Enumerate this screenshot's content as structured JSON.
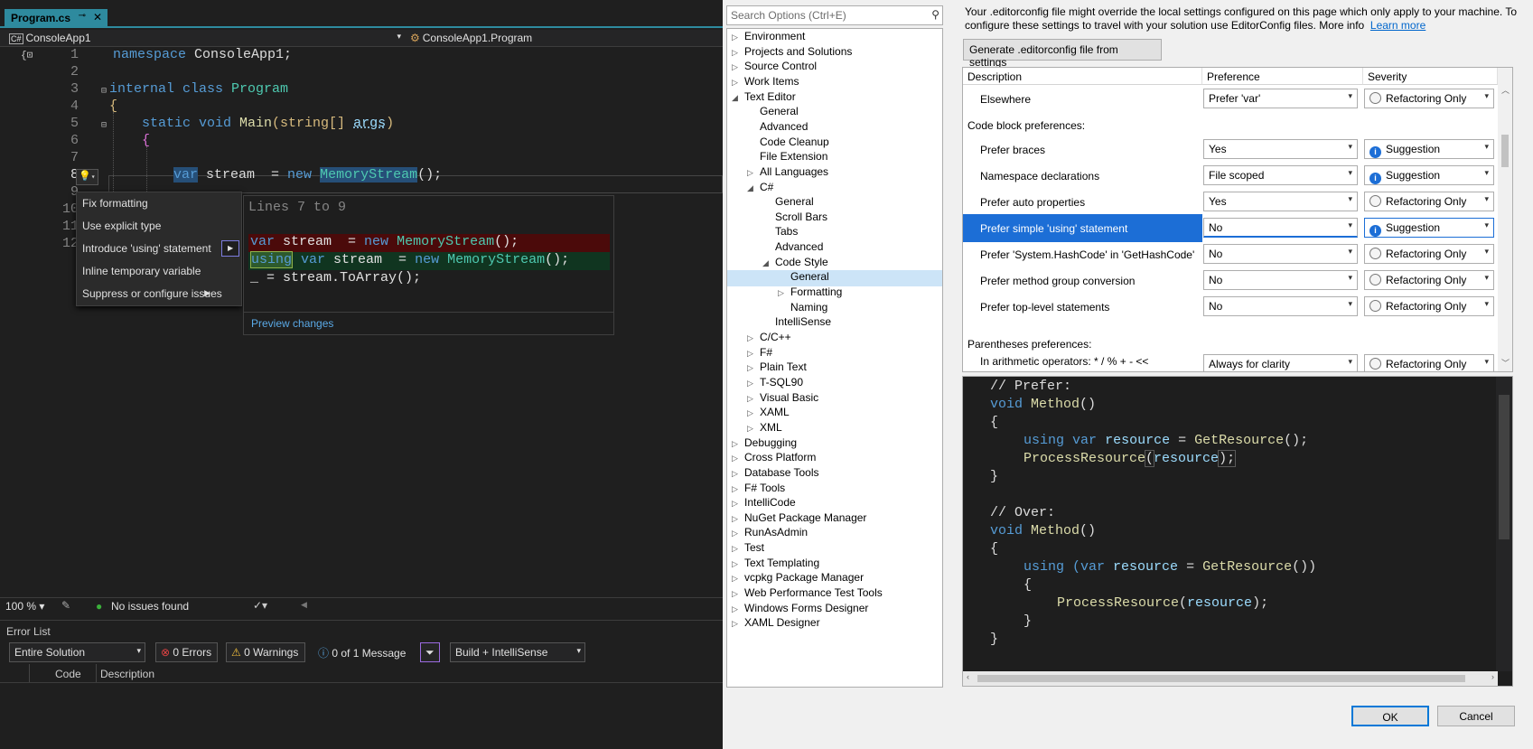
{
  "ide": {
    "tab_title": "Program.cs",
    "tab_pin": "⊸",
    "tab_close": "✕",
    "nav_project": "ConsoleApp1",
    "nav_type": "ConsoleApp1.Program",
    "line_numbers": [
      "1",
      "2",
      "3",
      "4",
      "5",
      "6",
      "7",
      "8",
      "9",
      "10",
      "11",
      "12"
    ],
    "code": {
      "l1_kw": "namespace",
      "l1_rest": " ConsoleApp1;",
      "l3_kw": "internal",
      "l3_kw2": " class ",
      "l3_ty": "Program",
      "l4": "{",
      "l5_kw": "static",
      "l5_kw2": " void ",
      "l5_mt": "Main",
      "l5_rest": "(string[] ",
      "l5_pm": "args",
      "l5_end": ")",
      "l6": "{",
      "l8_kw": "var",
      "l8_rest": " stream  = ",
      "l8_new": "new",
      "l8_ty": "MemoryStream",
      "l8_end": "();"
    },
    "quick_actions": {
      "items": [
        {
          "label": "Fix formatting"
        },
        {
          "label": "Use explicit type"
        },
        {
          "label": "Introduce 'using' statement"
        },
        {
          "label": "Inline temporary variable"
        },
        {
          "label": "Suppress or configure issues"
        }
      ]
    },
    "preview": {
      "header": "Lines 7 to 9",
      "removed_kw": "var",
      "removed_rest": " stream  = ",
      "removed_new": "new",
      "removed_ty": "MemoryStream",
      "removed_end": "();",
      "added_using": "using",
      "added_kw": "var",
      "added_rest": " stream  = ",
      "added_new": "new",
      "added_ty": "MemoryStream",
      "added_end": "();",
      "line3": "_ = stream.ToArray();",
      "preview_link": "Preview changes"
    },
    "status": {
      "zoom": "100 %",
      "issues": "No issues found"
    },
    "error_list": {
      "title": "Error List",
      "scope": "Entire Solution",
      "errors": "0 Errors",
      "warnings": "0 Warnings",
      "messages": "0 of 1 Message",
      "build_filter": "Build + IntelliSense",
      "col_code": "Code",
      "col_desc": "Description"
    }
  },
  "options": {
    "search_placeholder": "Search Options (Ctrl+E)",
    "tree": [
      {
        "label": "Environment",
        "level": 0,
        "arrow": "▷"
      },
      {
        "label": "Projects and Solutions",
        "level": 0,
        "arrow": "▷"
      },
      {
        "label": "Source Control",
        "level": 0,
        "arrow": "▷"
      },
      {
        "label": "Work Items",
        "level": 0,
        "arrow": "▷"
      },
      {
        "label": "Text Editor",
        "level": 0,
        "arrow": "◢"
      },
      {
        "label": "General",
        "level": 1,
        "arrow": ""
      },
      {
        "label": "Advanced",
        "level": 1,
        "arrow": ""
      },
      {
        "label": "Code Cleanup",
        "level": 1,
        "arrow": ""
      },
      {
        "label": "File Extension",
        "level": 1,
        "arrow": ""
      },
      {
        "label": "All Languages",
        "level": 1,
        "arrow": "▷"
      },
      {
        "label": "C#",
        "level": 1,
        "arrow": "◢"
      },
      {
        "label": "General",
        "level": 2,
        "arrow": ""
      },
      {
        "label": "Scroll Bars",
        "level": 2,
        "arrow": ""
      },
      {
        "label": "Tabs",
        "level": 2,
        "arrow": ""
      },
      {
        "label": "Advanced",
        "level": 2,
        "arrow": ""
      },
      {
        "label": "Code Style",
        "level": 2,
        "arrow": "◢"
      },
      {
        "label": "General",
        "level": 3,
        "arrow": ""
      },
      {
        "label": "Formatting",
        "level": 3,
        "arrow": "▷"
      },
      {
        "label": "Naming",
        "level": 3,
        "arrow": ""
      },
      {
        "label": "IntelliSense",
        "level": 2,
        "arrow": ""
      },
      {
        "label": "C/C++",
        "level": 1,
        "arrow": "▷"
      },
      {
        "label": "F#",
        "level": 1,
        "arrow": "▷"
      },
      {
        "label": "Plain Text",
        "level": 1,
        "arrow": "▷"
      },
      {
        "label": "T-SQL90",
        "level": 1,
        "arrow": "▷"
      },
      {
        "label": "Visual Basic",
        "level": 1,
        "arrow": "▷"
      },
      {
        "label": "XAML",
        "level": 1,
        "arrow": "▷"
      },
      {
        "label": "XML",
        "level": 1,
        "arrow": "▷"
      },
      {
        "label": "Debugging",
        "level": 0,
        "arrow": "▷"
      },
      {
        "label": "Cross Platform",
        "level": 0,
        "arrow": "▷"
      },
      {
        "label": "Database Tools",
        "level": 0,
        "arrow": "▷"
      },
      {
        "label": "F# Tools",
        "level": 0,
        "arrow": "▷"
      },
      {
        "label": "IntelliCode",
        "level": 0,
        "arrow": "▷"
      },
      {
        "label": "NuGet Package Manager",
        "level": 0,
        "arrow": "▷"
      },
      {
        "label": "RunAsAdmin",
        "level": 0,
        "arrow": "▷"
      },
      {
        "label": "Test",
        "level": 0,
        "arrow": "▷"
      },
      {
        "label": "Text Templating",
        "level": 0,
        "arrow": "▷"
      },
      {
        "label": "vcpkg Package Manager",
        "level": 0,
        "arrow": "▷"
      },
      {
        "label": "Web Performance Test Tools",
        "level": 0,
        "arrow": "▷"
      },
      {
        "label": "Windows Forms Designer",
        "level": 0,
        "arrow": "▷"
      },
      {
        "label": "XAML Designer",
        "level": 0,
        "arrow": "▷"
      }
    ],
    "selected_tree_index": 16,
    "info_text": "Your .editorconfig file might override the local settings configured on this page which only apply to your machine. To configure these settings to travel with your solution use EditorConfig files. More info",
    "learn_more": "Learn more",
    "generate_button": "Generate .editorconfig file from settings",
    "grid": {
      "col_description": "Description",
      "col_preference": "Preference",
      "col_severity": "Severity",
      "elsewhere": {
        "desc": "Elsewhere",
        "pref": "Prefer 'var'",
        "sev": "Refactoring Only"
      },
      "group_code_block": "Code block preferences:",
      "rows": [
        {
          "desc": "Prefer braces",
          "pref": "Yes",
          "sev": "Suggestion",
          "icon": "sg"
        },
        {
          "desc": "Namespace declarations",
          "pref": "File scoped",
          "sev": "Suggestion",
          "icon": "sg"
        },
        {
          "desc": "Prefer auto properties",
          "pref": "Yes",
          "sev": "Refactoring Only",
          "icon": "ro"
        },
        {
          "desc": "Prefer simple 'using' statement",
          "pref": "No",
          "sev": "Suggestion",
          "icon": "sg"
        },
        {
          "desc": "Prefer 'System.HashCode' in 'GetHashCode'",
          "pref": "No",
          "sev": "Refactoring Only",
          "icon": "ro"
        },
        {
          "desc": "Prefer method group conversion",
          "pref": "No",
          "sev": "Refactoring Only",
          "icon": "ro"
        },
        {
          "desc": "Prefer top-level statements",
          "pref": "No",
          "sev": "Refactoring Only",
          "icon": "ro"
        }
      ],
      "selected_row": 3,
      "group_parens": "Parentheses preferences:",
      "arith": {
        "desc": "In arithmetic operators:  *  /  %  +  -  <<",
        "pref": "Always for clarity",
        "sev": "Refactoring Only"
      }
    },
    "code_preview": {
      "prefer_comment": "// Prefer:",
      "over_comment": "// Over:",
      "void": "void",
      "method": "Method",
      "parens": "()",
      "open": "{",
      "close": "}",
      "using": "using",
      "var": "var",
      "resource": "resource",
      "eq": " = ",
      "getres": "GetResource",
      "call_end": "();",
      "process": "ProcessResource",
      "paren_open": "(",
      "paren_close": ");",
      "using_paren": "using (",
      "close_paren": "())"
    },
    "ok_label": "OK",
    "cancel_label": "Cancel"
  },
  "colors": {
    "accent": "#2e8a9e",
    "selection": "#1c6ed6",
    "diff_removed": "#4b0a0a",
    "diff_added": "#103520"
  }
}
